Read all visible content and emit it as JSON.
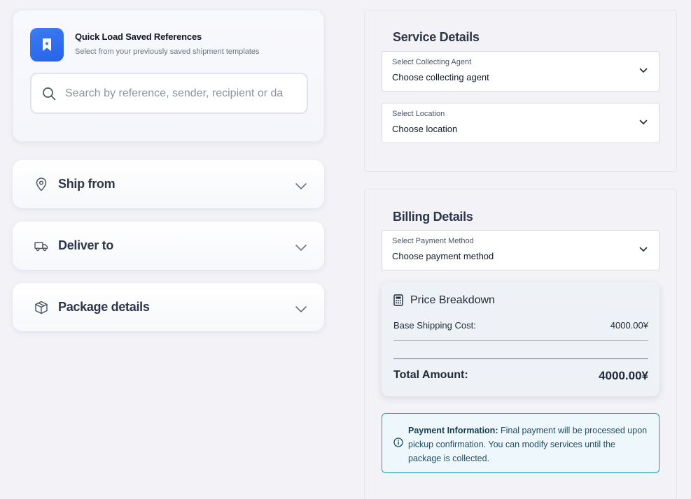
{
  "quick_load": {
    "title": "Quick Load Saved References",
    "subtitle": "Select from your previously saved shipment templates",
    "search_placeholder": "Search by reference, sender, recipient or da"
  },
  "sections": [
    {
      "label": "Ship from",
      "icon": "map-pin-icon"
    },
    {
      "label": "Deliver to",
      "icon": "truck-icon"
    },
    {
      "label": "Package details",
      "icon": "package-icon"
    }
  ],
  "service_details": {
    "title": "Service Details",
    "collecting_agent": {
      "label": "Select Collecting Agent",
      "value": "Choose collecting agent"
    },
    "location": {
      "label": "Select Location",
      "value": "Choose location"
    }
  },
  "billing_details": {
    "title": "Billing Details",
    "payment_method": {
      "label": "Select Payment Method",
      "value": "Choose payment method"
    },
    "price_breakdown": {
      "title": "Price Breakdown",
      "base_label": "Base Shipping Cost:",
      "base_value": "4000.00¥",
      "total_label": "Total Amount:",
      "total_value": "4000.00¥"
    },
    "payment_info": {
      "heading": "Payment Information:",
      "text": " Final payment will be processed upon pickup confirmation. You can modify services until the package is collected."
    }
  },
  "colors": {
    "accent": "#2563eb",
    "info_border": "#1aa0ac",
    "background": "#f2f2f7"
  }
}
